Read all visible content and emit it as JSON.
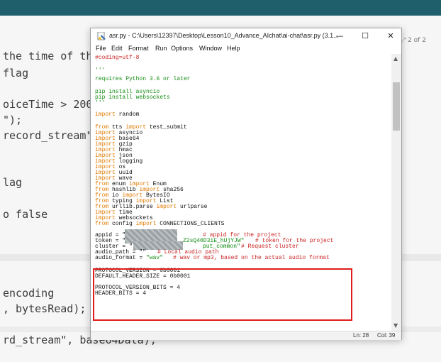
{
  "background": {
    "lines": [
      "the time of th",
      " flag",
      "oiceTime > 200",
      "\");",
      "record_stream\"",
      "lag",
      "o false",
      " encoding",
      ", bytesRead);",
      "rd_stream\", base64Data);"
    ],
    "page_indicator": "2 of 2"
  },
  "window": {
    "title": "asr.py - C:\\Users\\12397\\Desktop\\Lesson10_Advance_AIchat\\ai-chat\\asr.py (3.1...",
    "minimize": "—",
    "maximize": "☐",
    "close": "✕",
    "menu": [
      "File",
      "Edit",
      "Format",
      "Run",
      "Options",
      "Window",
      "Help"
    ],
    "code": {
      "l1": "#coding=utf-8",
      "l2": "'''",
      "l3": "requires Python 3.6 or later",
      "l4": "pip install asyncio",
      "l5": "pip install websockets",
      "l6": "'''",
      "import": "import",
      "from": "from",
      "random": " random",
      "tts_a": " tts ",
      "tts_b": " test_submit",
      "m1": " asyncio",
      "m2": " base64",
      "m3": " gzip",
      "m4": " hmac",
      "m5": " json",
      "m6": " logging",
      "m7": " os",
      "m8": " uuid",
      "m9": " wave",
      "f1a": " enum ",
      "f1b": " Enum",
      "f2a": " hashlib ",
      "f2b": " sha256",
      "f3a": " io ",
      "f3b": " BytesIO",
      "f4a": " typing ",
      "f4b": " List",
      "f5a": " urllib.parse ",
      "f5b": " urlparse",
      "m10": " time",
      "m11": " websockets",
      "f6a": " config ",
      "f6b": " CONNECTIONS_CLIENTS",
      "appid": "appid = \"",
      "appid_cm": "# appid for the project",
      "token": "token = \"",
      "token_str": "Z2sQ40D3iE_hUjYJW\"",
      "token_cm": "#  token for the project",
      "cluster": "cluster = \"",
      "cluster_str": "put_common\"",
      "cluster_cm": "# Request cluster",
      "audio_path": "audio_path = \"\"",
      "audio_path_cm": "# Local audio path",
      "audio_format": "audio_format = ",
      "audio_format_str": "\"wav\"",
      "audio_format_cm": "# wav or mp3, based on the actual audio format",
      "pv": "PROTOCOL_VERSION = 0b0001",
      "dh": "DEFAULT_HEADER_SIZE = 0b0001",
      "pvb": "PROTOCOL_VERSION_BITS = 4",
      "hb": "HEADER_BITS = 4"
    },
    "status": {
      "line": "Ln: 28",
      "col": "Col: 39"
    }
  },
  "colors": {
    "keyword": "#e07a00",
    "string": "#118a11",
    "comment": "#c81f1f",
    "highlight_box": "#e11c1c",
    "top_bar": "#1f5f6b"
  }
}
